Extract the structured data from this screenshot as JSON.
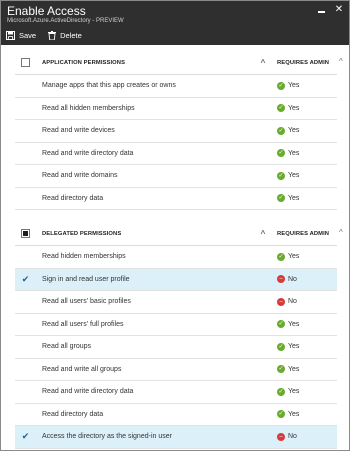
{
  "header": {
    "title": "Enable Access",
    "subtitle": "Microsoft.Azure.ActiveDirectory - PREVIEW",
    "minimize_icon": "minimize-icon",
    "close_glyph": "✕"
  },
  "toolbar": {
    "save_label": "Save",
    "delete_label": "Delete"
  },
  "application_permissions": {
    "title": "APPLICATION PERMISSIONS",
    "column_header": "REQUIRES ADMIN",
    "sort_glyph": "^",
    "collapse_glyph": "^",
    "rows": [
      {
        "label": "Manage apps that this app creates or owns",
        "status": "Yes",
        "checked": false
      },
      {
        "label": "Read all hidden memberships",
        "status": "Yes",
        "checked": false
      },
      {
        "label": "Read and write devices",
        "status": "Yes",
        "checked": false
      },
      {
        "label": "Read and write directory data",
        "status": "Yes",
        "checked": false
      },
      {
        "label": "Read and write domains",
        "status": "Yes",
        "checked": false
      },
      {
        "label": "Read directory data",
        "status": "Yes",
        "checked": false
      }
    ]
  },
  "delegated_permissions": {
    "title": "DELEGATED PERMISSIONS",
    "column_header": "REQUIRES ADMIN",
    "sort_glyph": "^",
    "collapse_glyph": "^",
    "rows": [
      {
        "label": "Read hidden memberships",
        "status": "Yes",
        "checked": false
      },
      {
        "label": "Sign in and read user profile",
        "status": "No",
        "checked": true
      },
      {
        "label": "Read all users' basic profiles",
        "status": "No",
        "checked": false
      },
      {
        "label": "Read all users' full profiles",
        "status": "Yes",
        "checked": false
      },
      {
        "label": "Read all groups",
        "status": "Yes",
        "checked": false
      },
      {
        "label": "Read and write all groups",
        "status": "Yes",
        "checked": false
      },
      {
        "label": "Read and write directory data",
        "status": "Yes",
        "checked": false
      },
      {
        "label": "Read directory data",
        "status": "Yes",
        "checked": false
      },
      {
        "label": "Access the directory as the signed-in user",
        "status": "No",
        "checked": true
      }
    ]
  },
  "colors": {
    "header_bg": "#2f2f2f",
    "selected_row": "#dcf0fa",
    "yes": "#6aaa2c",
    "no": "#d63b3b"
  }
}
